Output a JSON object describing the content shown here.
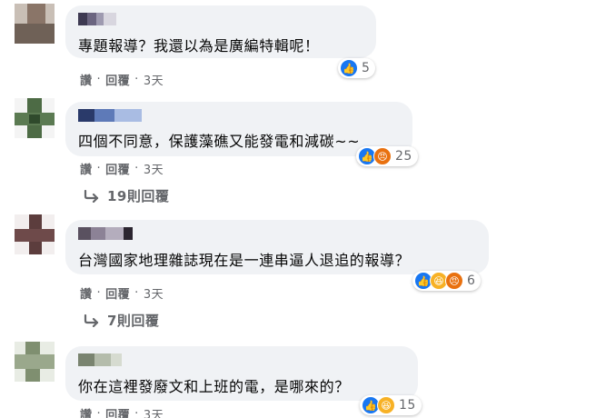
{
  "comments": [
    {
      "text": "專題報導？我還以為是廣編特輯呢！",
      "actions": {
        "like": "讚",
        "reply": "回覆",
        "time": "3天"
      },
      "reactions": {
        "icons": [
          "like-icon"
        ],
        "count": "5"
      }
    },
    {
      "text": "四個不同意，保護藻礁又能發電和減碳~~",
      "actions": {
        "like": "讚",
        "reply": "回覆",
        "time": "3天"
      },
      "reactions": {
        "icons": [
          "like-icon",
          "angry-icon"
        ],
        "count": "25"
      },
      "replies": "19則回覆"
    },
    {
      "text": "台灣國家地理雜誌現在是一連串逼人退追的報導？",
      "actions": {
        "like": "讚",
        "reply": "回覆",
        "time": "3天"
      },
      "reactions": {
        "icons": [
          "like-icon",
          "haha-icon",
          "angry-icon"
        ],
        "count": "6"
      },
      "replies": "7則回覆"
    },
    {
      "text": "你在這裡發廢文和上班的電，是哪來的？",
      "actions": {
        "like": "讚",
        "reply": "回覆",
        "time": "3天"
      },
      "reactions": {
        "icons": [
          "like-icon",
          "haha-icon"
        ],
        "count": "15"
      }
    }
  ],
  "colors": {
    "bubble": "#f0f2f5",
    "like": "#1877f2",
    "angry": "#e9710f",
    "haha": "#f7b125",
    "meta_text": "#65676b"
  }
}
